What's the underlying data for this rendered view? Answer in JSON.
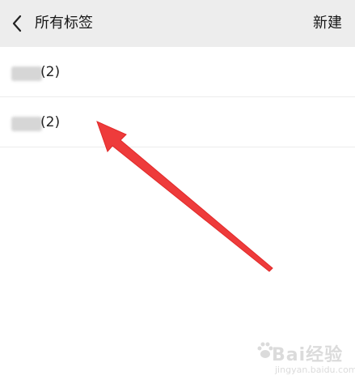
{
  "header": {
    "title": "所有标签",
    "new_label": "新建"
  },
  "tags": [
    {
      "name": "",
      "count_label": "(2)"
    },
    {
      "name": "",
      "count_label": "(2)"
    }
  ],
  "watermark": {
    "brand": "Bai经验",
    "url": "jingyan.baidu.com"
  },
  "colors": {
    "header_bg": "#ededed",
    "arrow": "#ee3b3b"
  }
}
